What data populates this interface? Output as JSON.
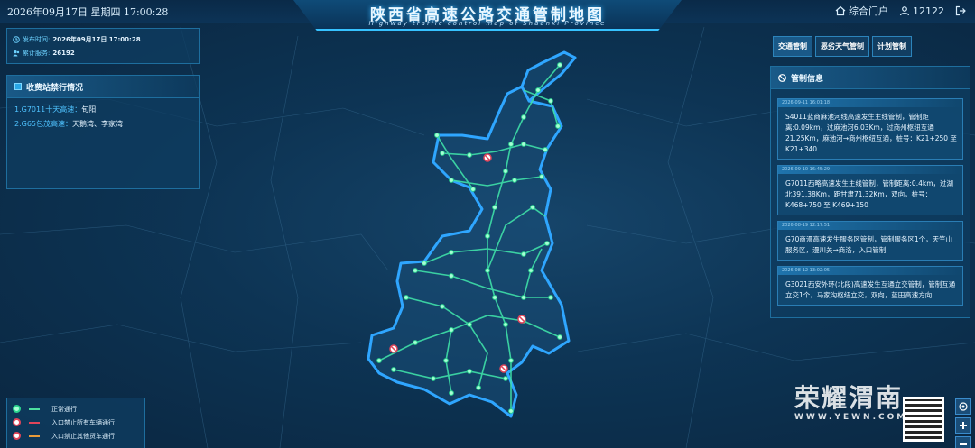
{
  "header": {
    "datetime": "2026年09月17日 星期四   17:00:28",
    "title": "陕西省高速公路交通管制地图",
    "subtitle": "Highway traffic control map of Shaanxi Province",
    "portal_label": "综合门户",
    "user_id": "12122"
  },
  "info": {
    "publish_key": "发布时间:",
    "publish_val": "2026年09月17日 17:00:28",
    "service_key": "累计服务:",
    "service_val": "26192"
  },
  "toll": {
    "title": "收费站禁行情况",
    "items": [
      {
        "road": "1.G7011十天高速：",
        "stations": "旬阳"
      },
      {
        "road": "2.G65包茂高速：",
        "stations": "天鹅湾、李家湾"
      }
    ]
  },
  "tabs": [
    "交通管制",
    "恶劣天气管制",
    "计划管制"
  ],
  "control": {
    "title": "管制信息",
    "items": [
      {
        "time": "2026-09-11 16:01:18",
        "text": "S4011蓝商麻池河线高速发生主线管制，管制距离:0.09km，过麻池河6.03Km，过商州枢纽互通21.25Km，麻池河→商州枢纽互通，桩号：K21+250 至 K21+340"
      },
      {
        "time": "2026-09-10 16:45:29",
        "text": "G7011西略高速发生主线管制，管制距离:0.4km，过湖北391.38Km，距甘肃71.32Km，双向，桩号：K468+750 至 K469+150"
      },
      {
        "time": "2026-08-19 12:17:51",
        "text": "G70商漫高速发生服务区管制，管制服务区1个，天竺山服务区，漫川关→商洛，入口管制"
      },
      {
        "time": "2026-08-12 13:02:05",
        "text": "G3021西安外环(北段)高速发生互通立交管制，管制互通立交1个，马家沟枢纽立交，双向，蓝田高速方向"
      }
    ]
  },
  "legend": [
    {
      "label": "正常通行",
      "color": "#4de0a0"
    },
    {
      "label": "入口禁止所有车辆通行",
      "color": "#e0455a"
    },
    {
      "label": "入口禁止其他货车通行",
      "color": "#e89b3a"
    }
  ],
  "watermark": {
    "main": "荣耀渭南",
    "url": "WWW.YEWN.COM"
  },
  "colors": {
    "accent": "#36c2ff",
    "road": "#3fe0a8",
    "province_border": "#2fa6ff"
  }
}
